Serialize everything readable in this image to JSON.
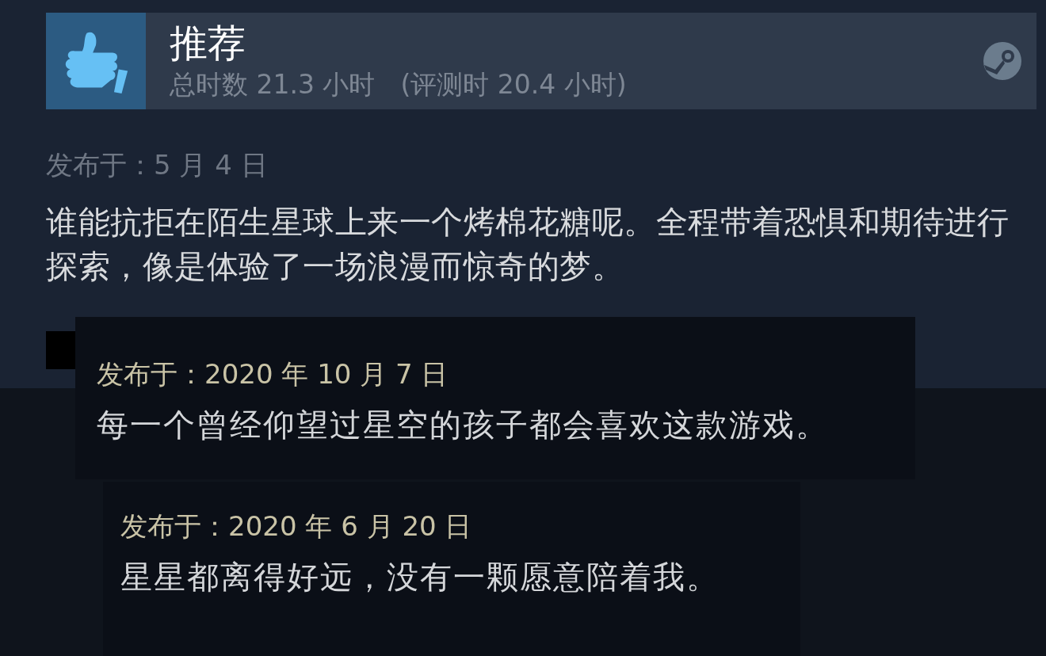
{
  "review": {
    "verdict": "推荐",
    "playtime": "总时数 21.3 小时",
    "playtime_at_review": "(评测时 20.4 小时)",
    "posted": "发布于：5 月 4 日",
    "text": "谁能抗拒在陌生星球上来一个烤棉花糖呢。全程带着恐惧和期待进行探索，像是体验了一场浪漫而惊奇的梦。"
  },
  "overlays": [
    {
      "posted": "发布于：2020 年 10 月 7 日",
      "text": "每一个曾经仰望过星空的孩子都会喜欢这款游戏。"
    },
    {
      "posted": "发布于：2020 年 6 月 20 日",
      "text": "星星都离得好远，没有一颗愿意陪着我。"
    }
  ]
}
